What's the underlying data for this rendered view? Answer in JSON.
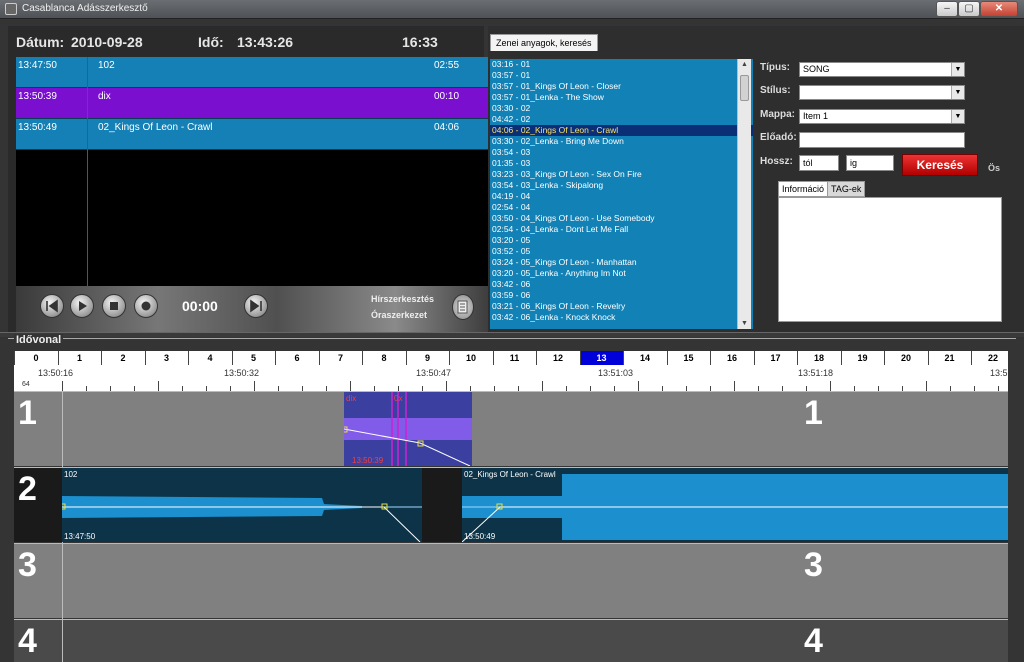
{
  "window": {
    "title": "Casablanca Adásszerkesztő",
    "controls": {
      "minimize": "–",
      "maximize": "▢",
      "close": "✕"
    }
  },
  "player": {
    "date_label": "Dátum:",
    "date_value": "2010-09-28",
    "time_label": "Idő:",
    "time_value": "13:43:26",
    "remaining": "16:33",
    "rows": [
      {
        "time": "13:47:50",
        "title": "102",
        "duration": "02:55",
        "color": "#1580b5"
      },
      {
        "time": "13:50:39",
        "title": "dix",
        "duration": "00:10",
        "color": "#7a0fd0"
      },
      {
        "time": "13:50:49",
        "title": "02_Kings Of Leon - Crawl",
        "duration": "04:06",
        "color": "#1580b5"
      }
    ],
    "transport_time": "00:00",
    "news_edit": "Hírszerkesztés",
    "hour_edit": "Óraszerkezet"
  },
  "music_panel": {
    "tab_label": "Zenei anyagok, keresés",
    "songs": [
      "03:16 - 01",
      "03:57 - 01",
      "03:57 - 01_Kings Of Leon - Closer",
      "03:57 - 01_Lenka - The Show",
      "03:30 - 02",
      "04:42 - 02",
      "04:06 - 02_Kings Of Leon - Crawl",
      "03:30 - 02_Lenka - Bring Me Down",
      "03:54 - 03",
      "01:35 - 03",
      "03:23 - 03_Kings Of Leon - Sex On Fire",
      "03:54 - 03_Lenka - Skipalong",
      "04:19 - 04",
      "02:54 - 04",
      "03:50 - 04_Kings Of Leon - Use Somebody",
      "02:54 - 04_Lenka - Dont Let Me Fall",
      "03:20 - 05",
      "03:52 - 05",
      "03:24 - 05_Kings Of Leon - Manhattan",
      "03:20 - 05_Lenka - Anything Im Not",
      "03:42 - 06",
      "03:59 - 06",
      "03:21 - 06_Kings Of Leon - Revelry",
      "03:42 - 06_Lenka - Knock Knock"
    ],
    "selected_index": 6,
    "type_label": "Típus:",
    "type_value": "SONG",
    "style_label": "Stílus:",
    "style_value": "",
    "folder_label": "Mappa:",
    "folder_value": "Item 1",
    "performer_label": "Előadó:",
    "performer_value": "",
    "length_label": "Hossz:",
    "from_value": "tól",
    "to_value": "ig",
    "search_button": "Keresés",
    "os_label": "Ös",
    "info_tab": "Információ",
    "tags_tab": "TAG-ek"
  },
  "timeline": {
    "title": "Idővonal",
    "ruler": [
      "0",
      "1",
      "2",
      "3",
      "4",
      "5",
      "6",
      "7",
      "8",
      "9",
      "10",
      "11",
      "12",
      "13",
      "14",
      "15",
      "16",
      "17",
      "18",
      "19",
      "20",
      "21",
      "22"
    ],
    "active_index": 13,
    "scale_value": "64",
    "timestamps": [
      "13:50:16",
      "13:50:32",
      "13:50:47",
      "13:51:03",
      "13:51:18",
      "13:5"
    ],
    "tracks": [
      {
        "number": "1",
        "right_number": "1"
      },
      {
        "number": "2",
        "right_number": ""
      },
      {
        "number": "3",
        "right_number": "3"
      },
      {
        "number": "4",
        "right_number": "4"
      }
    ],
    "clip_dix": {
      "label": "dix",
      "marker": "0x",
      "time": "13:50:39"
    },
    "clip_102": {
      "label": "102",
      "time": "13:47:50"
    },
    "clip_crawl": {
      "label": "02_Kings Of Leon - Crawl",
      "time": "13:50:49"
    }
  }
}
